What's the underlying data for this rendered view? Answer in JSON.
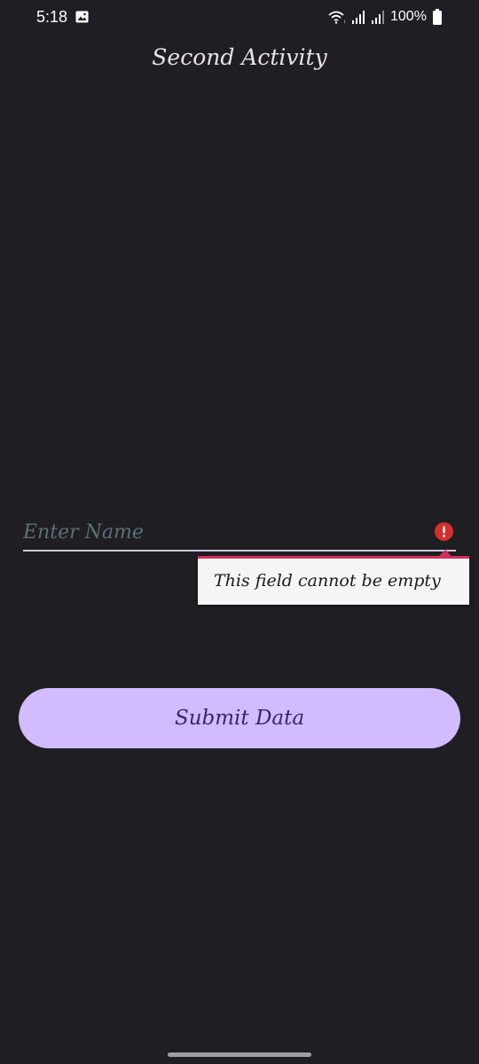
{
  "status_bar": {
    "time": "5:18",
    "battery": "100%",
    "icons": [
      "gallery-icon",
      "wifi-icon",
      "signal-icon",
      "signal-icon",
      "battery-icon"
    ]
  },
  "header": {
    "title": "Second Activity"
  },
  "form": {
    "name_value": "",
    "name_placeholder": "Enter Name",
    "error_message": "This field cannot be empty",
    "submit_label": "Submit Data"
  },
  "colors": {
    "background": "#1f1e22",
    "button": "#d0bcfe",
    "button_text": "#3b2467",
    "error": "#d32f2f"
  }
}
